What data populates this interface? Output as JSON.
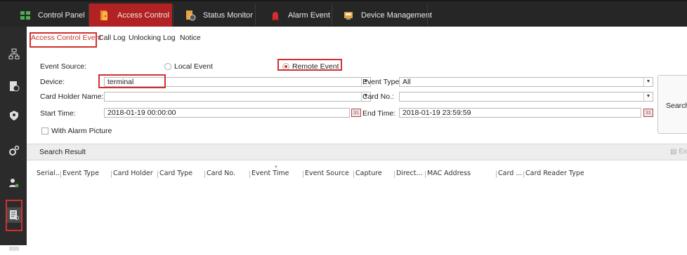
{
  "top_tabs": [
    {
      "label": "Control Panel",
      "icon": "grid-icon"
    },
    {
      "label": "Access Control",
      "icon": "door-icon"
    },
    {
      "label": "Status Monitor",
      "icon": "status-icon"
    },
    {
      "label": "Alarm Event",
      "icon": "alarm-icon"
    },
    {
      "label": "Device Management",
      "icon": "device-icon"
    }
  ],
  "sidebar_icons": [
    "org-tree-icon",
    "person-card-icon",
    "shield-icon",
    "gear-icon",
    "person-settings-icon",
    "search-record-icon"
  ],
  "subtabs": [
    "Access Control Event",
    "Call Log",
    "Unlocking Log",
    "Notice"
  ],
  "form": {
    "event_source_label": "Event Source:",
    "local_event": "Local Event",
    "remote_event": "Remote Event",
    "selected_source": "Remote Event",
    "device_label": "Device:",
    "device_value": "terminal",
    "event_type_label": "Event Type:",
    "event_type_value": "All",
    "card_holder_label": "Card Holder Name:",
    "card_holder_value": "",
    "card_no_label": "Card No.:",
    "card_no_value": "",
    "start_time_label": "Start Time:",
    "start_time_value": "2018-01-19 00:00:00",
    "end_time_label": "End Time:",
    "end_time_value": "2018-01-19 23:59:59",
    "alarm_picture_label": "With Alarm Picture",
    "alarm_picture_checked": false,
    "search_button": "Search"
  },
  "result": {
    "title": "Search Result",
    "export_label": "Ex"
  },
  "columns": [
    "Serial...",
    "Event Type",
    "Card Holder",
    "Card Type",
    "Card No.",
    "Event Time",
    "Event Source",
    "Capture",
    "Direct...",
    "MAC Address",
    "Card ...",
    "Card Reader Type"
  ],
  "rows": [],
  "colors": {
    "accent_red": "#d32f2f",
    "active_tab": "#b22222",
    "topbar": "#262626",
    "sidebar": "#2b2b2b"
  }
}
